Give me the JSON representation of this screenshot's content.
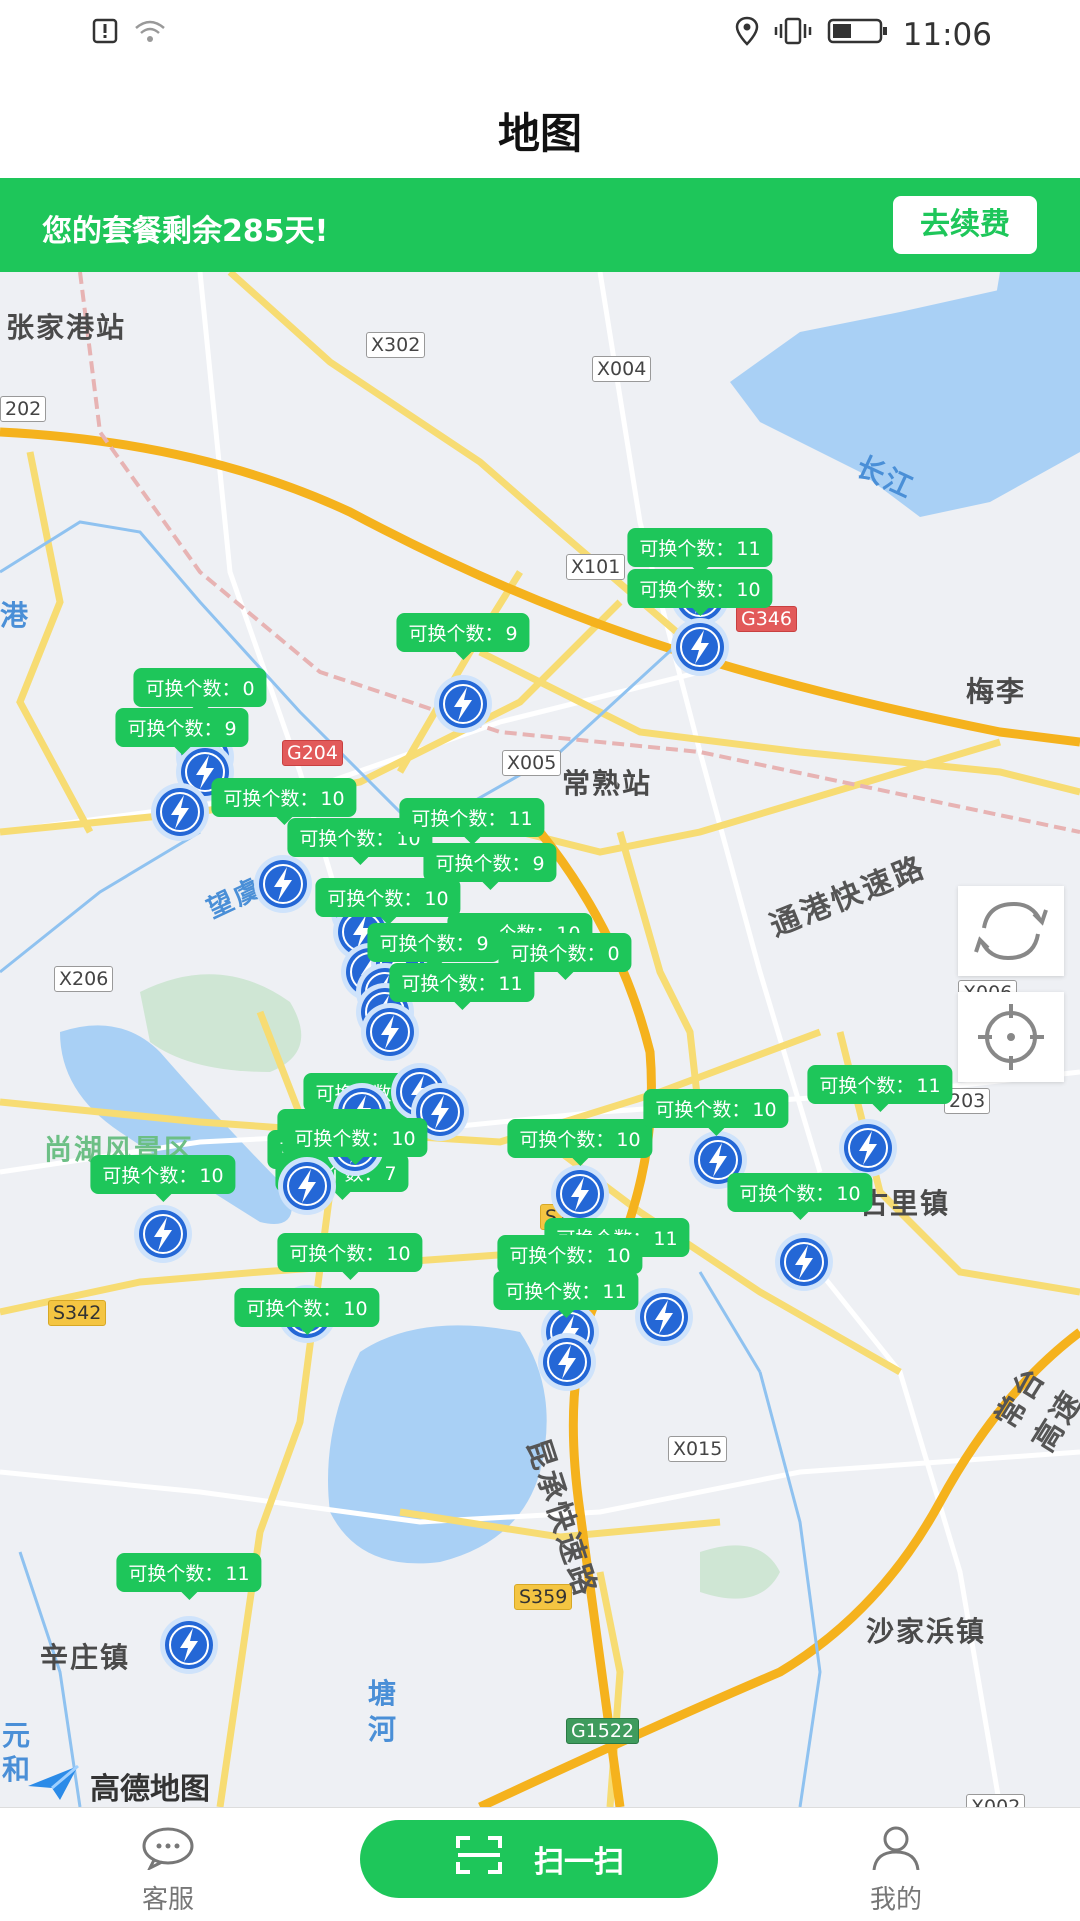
{
  "status_bar": {
    "time": "11:06"
  },
  "header": {
    "title": "地图"
  },
  "banner": {
    "message": "您的套餐剩余285天!",
    "renew_label": "去续费"
  },
  "map": {
    "provider": "高德地图",
    "places": [
      "张家港站",
      "常熟站",
      "梅李",
      "尚湖风景区",
      "古里镇",
      "沙家浜镇",
      "辛庄镇",
      "塘",
      "河",
      "元",
      "和",
      "长江",
      "港"
    ],
    "roads": [
      "X302",
      "X004",
      "X101",
      "G346",
      "G204",
      "X005",
      "X206",
      "X006",
      "203",
      "S342",
      "X015",
      "S359",
      "G1522",
      "X002",
      "202",
      "S2",
      "通港快速路",
      "望虞河",
      "昆承快速路",
      "常台高速"
    ],
    "count_label": "可换个数：",
    "stations": [
      {
        "count": "11"
      },
      {
        "count": "10"
      },
      {
        "count": "9"
      },
      {
        "count": "0"
      },
      {
        "count": "9"
      },
      {
        "count": "10"
      },
      {
        "count": "10"
      },
      {
        "count": "11"
      },
      {
        "count": "9"
      },
      {
        "count": "10"
      },
      {
        "count": "10"
      },
      {
        "count": "9"
      },
      {
        "count": "0"
      },
      {
        "count": "11"
      },
      {
        "count": "9"
      },
      {
        "count": "10"
      },
      {
        "count": "9"
      },
      {
        "count": "7"
      },
      {
        "count": "10"
      },
      {
        "count": "10"
      },
      {
        "count": "10"
      },
      {
        "count": "10"
      },
      {
        "count": "10"
      },
      {
        "count": "10"
      },
      {
        "count": "11"
      },
      {
        "count": "10"
      },
      {
        "count": "11"
      },
      {
        "count": "10"
      },
      {
        "count": "11"
      },
      {
        "count": "11"
      }
    ]
  },
  "tabbar": {
    "service_label": "客服",
    "scan_label": "扫一扫",
    "mine_label": "我的"
  }
}
